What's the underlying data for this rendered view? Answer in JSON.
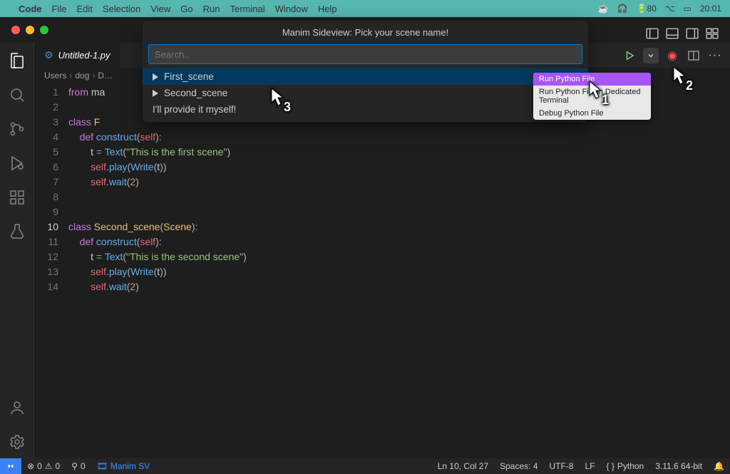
{
  "menubar": {
    "app_name": "Code",
    "items": [
      "File",
      "Edit",
      "Selection",
      "View",
      "Go",
      "Run",
      "Terminal",
      "Window",
      "Help"
    ],
    "status": {
      "dots": "…",
      "battery": "80",
      "time": "20:01"
    }
  },
  "tab": {
    "filename": "Untitled-1.py"
  },
  "breadcrumb": {
    "parts": [
      "Users",
      "dog",
      "D…"
    ]
  },
  "code_lines": [
    "from ma",
    "",
    "class F",
    "    def construct(self):",
    "        t = Text(\"This is the first scene\")",
    "        self.play(Write(t))",
    "        self.wait(2)",
    "",
    "",
    "class Second_scene(Scene):",
    "    def construct(self):",
    "        t = Text(\"This is the second scene\")",
    "        self.play(Write(t))",
    "        self.wait(2)"
  ],
  "quick_picker": {
    "title": "Manim Sideview: Pick your scene name!",
    "placeholder": "Search..",
    "items": [
      "First_scene",
      "Second_scene",
      "I'll provide it myself!"
    ]
  },
  "run_menu": {
    "items": [
      "Run Python File",
      "Run Python File in Dedicated Terminal",
      "Debug Python File"
    ]
  },
  "statusbar": {
    "errors": "0",
    "warnings": "0",
    "port": "0",
    "ext": "Manim SV",
    "cursor": "Ln 10, Col 27",
    "spaces": "Spaces: 4",
    "encoding": "UTF-8",
    "eol": "LF",
    "lang": "Python",
    "interp": "3.11.6 64-bit"
  },
  "annotations": {
    "c1": "1",
    "c2": "2",
    "c3": "3"
  }
}
